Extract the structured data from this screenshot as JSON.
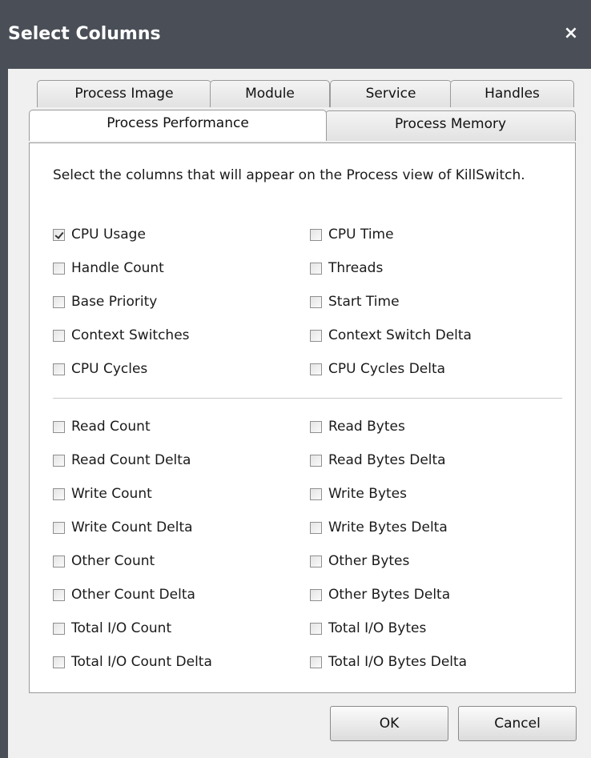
{
  "dialog": {
    "title": "Select Columns",
    "close_symbol": "×"
  },
  "tabs_row1": [
    {
      "label": "Process Image"
    },
    {
      "label": "Module"
    },
    {
      "label": "Service"
    },
    {
      "label": "Handles"
    }
  ],
  "tabs_row2": [
    {
      "label": "Process Performance",
      "active": true
    },
    {
      "label": "Process Memory",
      "active": false
    }
  ],
  "instructions": "Select the columns that will appear on the Process view of KillSwitch.",
  "group1": [
    {
      "label": "CPU Usage",
      "checked": true
    },
    {
      "label": "CPU Time",
      "checked": false
    },
    {
      "label": "Handle Count",
      "checked": false
    },
    {
      "label": "Threads",
      "checked": false
    },
    {
      "label": "Base Priority",
      "checked": false
    },
    {
      "label": "Start Time",
      "checked": false
    },
    {
      "label": "Context Switches",
      "checked": false
    },
    {
      "label": "Context Switch Delta",
      "checked": false
    },
    {
      "label": "CPU Cycles",
      "checked": false
    },
    {
      "label": "CPU Cycles Delta",
      "checked": false
    }
  ],
  "group2": [
    {
      "label": "Read Count",
      "checked": false
    },
    {
      "label": "Read Bytes",
      "checked": false
    },
    {
      "label": "Read Count Delta",
      "checked": false
    },
    {
      "label": "Read Bytes Delta",
      "checked": false
    },
    {
      "label": "Write Count",
      "checked": false
    },
    {
      "label": "Write Bytes",
      "checked": false
    },
    {
      "label": "Write Count Delta",
      "checked": false
    },
    {
      "label": "Write Bytes Delta",
      "checked": false
    },
    {
      "label": "Other Count",
      "checked": false
    },
    {
      "label": "Other Bytes",
      "checked": false
    },
    {
      "label": "Other Count Delta",
      "checked": false
    },
    {
      "label": "Other Bytes Delta",
      "checked": false
    },
    {
      "label": "Total I/O Count",
      "checked": false
    },
    {
      "label": "Total I/O Bytes",
      "checked": false
    },
    {
      "label": "Total I/O Count Delta",
      "checked": false
    },
    {
      "label": "Total I/O Bytes Delta",
      "checked": false
    }
  ],
  "buttons": {
    "ok": "OK",
    "cancel": "Cancel"
  },
  "colors": {
    "titlebar": "#4a4f57",
    "dialog_bg": "#f0f0f0",
    "panel_bg": "#ffffff"
  }
}
